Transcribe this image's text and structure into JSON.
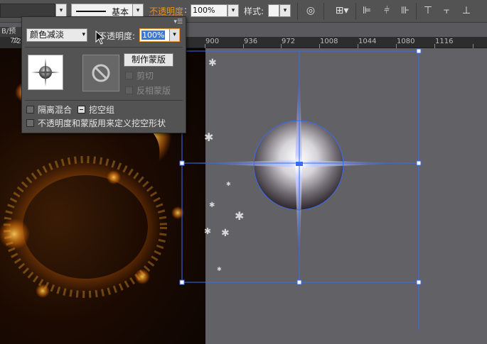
{
  "control_bar": {
    "stroke_profile_label": "基本",
    "opacity_label": "不透明度",
    "opacity_value": "100%",
    "style_label": "样式:"
  },
  "document_tab_fragment": "B/预",
  "ruler": {
    "ticks": [
      "72",
      "900",
      "936",
      "972",
      "1008",
      "1044",
      "1080",
      "1116"
    ]
  },
  "transparency_panel": {
    "blend_mode": "颜色减淡",
    "opacity_label": "不透明度:",
    "opacity_value": "100%",
    "make_mask_button": "制作蒙版",
    "clip_label": "剪切",
    "invert_mask_label": "反相蒙版",
    "isolate_blending_label": "隔离混合",
    "knockout_group_label": "挖空组",
    "opacity_mask_knockout_label": "不透明度和蒙版用来定义挖空形状"
  },
  "colors": {
    "opacity_link": "#e0922e",
    "selection_blue": "#3a6cf0",
    "canvas_gray": "#626166",
    "panel_bg": "#535353"
  }
}
